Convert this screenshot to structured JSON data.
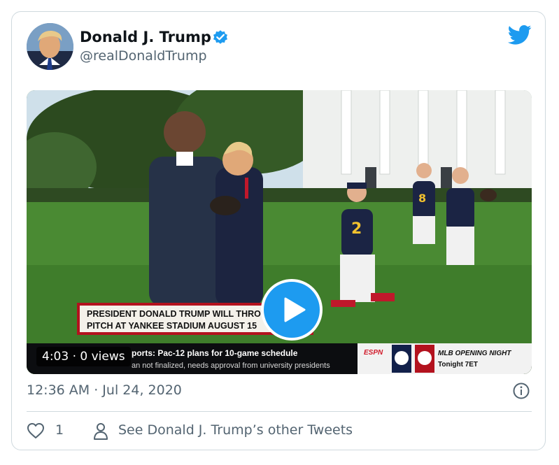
{
  "tweet": {
    "author_name": "Donald J. Trump",
    "handle": "@realDonaldTrump",
    "verified": true,
    "timestamp": "12:36 AM · Jul 24, 2020",
    "likes": "1",
    "other_tweets_label": "See Donald J. Trump’s other Tweets"
  },
  "video": {
    "duration_views": "4:03 · 0 views",
    "lower_third_line1": "PRESIDENT DONALD TRUMP WILL THROW OUT FIRST",
    "lower_third_line2": "PITCH AT YANKEE STADIUM AUGUST 15",
    "ticker_line1": "ports: Pac-12 plans for 10-game schedule",
    "ticker_line2": "an not finalized, needs approval from university presidents",
    "ticker_brand": "ESPN",
    "promo_line1": "MLB OPENING NIGHT",
    "promo_line2": "Tonight 7ET",
    "jersey_1": "2",
    "jersey_2": "8"
  },
  "icons": {
    "verified": "verified-badge-icon",
    "brand": "twitter-bird-icon",
    "play": "play-icon",
    "info": "info-icon",
    "like": "heart-icon",
    "profile": "person-icon"
  },
  "colors": {
    "accent": "#1d9bf0",
    "secondary_text": "#536471",
    "border": "#cfd9de",
    "lower_third_red": "#b3121e"
  }
}
